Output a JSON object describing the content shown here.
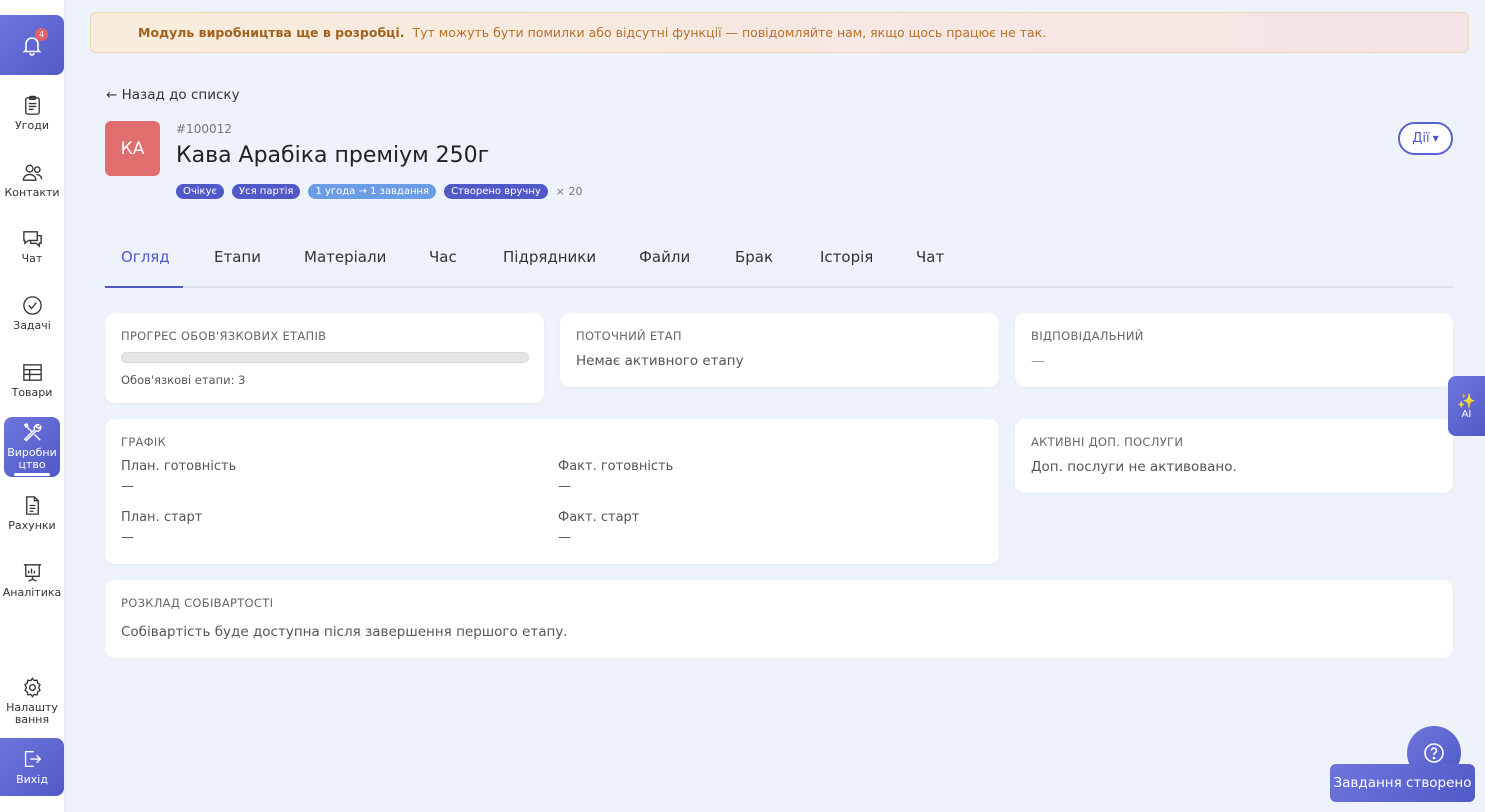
{
  "sidebar": {
    "notifications_count": "4",
    "items": [
      {
        "label": "Угоди",
        "icon": "clipboard-icon"
      },
      {
        "label": "Контакти",
        "icon": "users-icon"
      },
      {
        "label": "Чат",
        "icon": "chat-icon"
      },
      {
        "label": "Задачі",
        "icon": "check-circle-icon"
      },
      {
        "label": "Товари",
        "icon": "table-icon"
      },
      {
        "label": "Виробництво",
        "icon": "tools-icon",
        "active": true
      },
      {
        "label": "Рахунки",
        "icon": "document-icon"
      },
      {
        "label": "Аналітика",
        "icon": "presentation-icon"
      }
    ],
    "settings_label": "Налаштування",
    "logout_label": "Вихід",
    "accent": "#5159c8"
  },
  "banner": {
    "bold": "Модуль виробництва ще в розробці.",
    "text": "Тут можуть бути помилки або відсутні функції — повідомляйте нам, якщо щось працює не так."
  },
  "back_link": "← Назад до списку",
  "header": {
    "avatar_initials": "КА",
    "order_id": "#100012",
    "title": "Кава Арабіка преміум 250г",
    "badges": [
      {
        "label": "Очікує",
        "color": "#5159c8"
      },
      {
        "label": "Уся партія",
        "color": "#5159c8"
      },
      {
        "label": "1 угода → 1 завдання",
        "color": "#6b9de6"
      },
      {
        "label": "Створено вручну",
        "color": "#5159c8"
      }
    ],
    "quantity": "× 20",
    "actions_label": "Дії"
  },
  "tabs": [
    "Огляд",
    "Етапи",
    "Матеріали",
    "Час",
    "Підрядники",
    "Файли",
    "Брак",
    "Історія",
    "Чат"
  ],
  "cards": {
    "progress": {
      "title": "ПРОГРЕС ОБОВ'ЯЗКОВИХ ЕТАПІВ",
      "value": 0,
      "note": "Обов'язкові етапи: 3"
    },
    "current_stage": {
      "title": "ПОТОЧНИЙ ЕТАП",
      "text": "Немає активного етапу"
    },
    "responsible": {
      "title": "ВІДПОВІДАЛЬНИЙ",
      "text": "—"
    },
    "schedule": {
      "title": "ГРАФІК",
      "plan_ready_label": "План. готовність",
      "plan_ready": "—",
      "fact_ready_label": "Факт. готовність",
      "fact_ready": "—",
      "plan_start_label": "План. старт",
      "plan_start": "—",
      "fact_start_label": "Факт. старт",
      "fact_start": "—"
    },
    "services": {
      "title": "АКТИВНІ ДОП. ПОСЛУГИ",
      "text": "Доп. послуги не активовано."
    },
    "cost": {
      "title": "РОЗКЛАД СОБІВАРТОСТІ",
      "text": "Собівартість буде доступна після завершення першого етапу."
    }
  },
  "ai_label": "AI",
  "toast": "Завдання створено"
}
